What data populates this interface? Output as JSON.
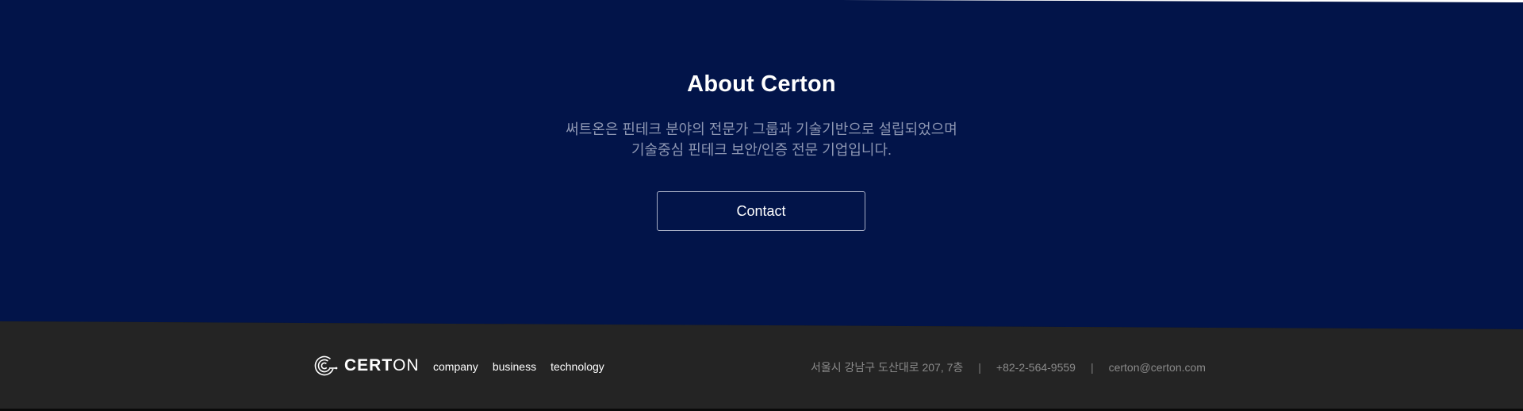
{
  "about": {
    "title": "About Certon",
    "description_line1": "써트온은 핀테크 분야의 전문가 그룹과 기술기반으로 설립되었으며",
    "description_line2": "기술중심 핀테크 보안/인증 전문 기업입니다.",
    "contact_label": "Contact"
  },
  "footer": {
    "logo": {
      "text_bold": "CERT",
      "text_light": "ON",
      "icon": "certon-logo-icon"
    },
    "nav": [
      "company",
      "business",
      "technology"
    ],
    "address": "서울시 강남구 도산대로 207, 7층",
    "separator": "|",
    "phone": "+82-2-564-9559",
    "email": "certon@certon.com"
  },
  "colors": {
    "about_background": "#021449",
    "footer_background": "#242424",
    "description_text": "#8e97b3",
    "footer_info_text": "#8a8a8a"
  }
}
